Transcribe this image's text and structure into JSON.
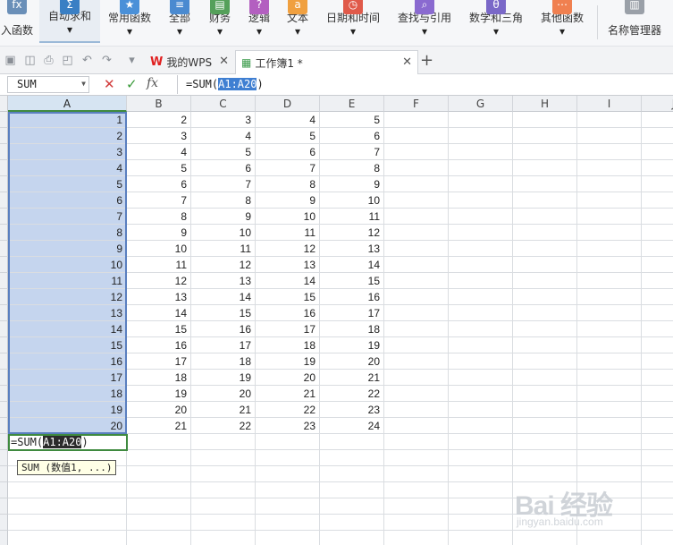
{
  "ribbon": {
    "items": [
      {
        "label": "入函数",
        "icon": "fx-icon",
        "glyph": "fx",
        "color": "#6a8fb8"
      },
      {
        "label": "自动求和",
        "icon": "sigma-icon",
        "glyph": "Σ",
        "color": "#3a7fc4"
      },
      {
        "label": "常用函数",
        "icon": "star-icon",
        "glyph": "★",
        "color": "#4a90d8"
      },
      {
        "label": "全部",
        "icon": "list-icon",
        "glyph": "≡",
        "color": "#4a8ad0"
      },
      {
        "label": "财务",
        "icon": "finance-icon",
        "glyph": "▤",
        "color": "#55a05a"
      },
      {
        "label": "逻辑",
        "icon": "question-icon",
        "glyph": "?",
        "color": "#b35fc0"
      },
      {
        "label": "文本",
        "icon": "text-icon",
        "glyph": "a",
        "color": "#f0a040"
      },
      {
        "label": "日期和时间",
        "icon": "clock-icon",
        "glyph": "◷",
        "color": "#e05a4a"
      },
      {
        "label": "查找与引用",
        "icon": "search-icon",
        "glyph": "⌕",
        "color": "#8a6ad0"
      },
      {
        "label": "数学和三角",
        "icon": "theta-icon",
        "glyph": "θ",
        "color": "#7a68c8"
      },
      {
        "label": "其他函数",
        "icon": "more-functions-icon",
        "glyph": "⋯",
        "color": "#f08050"
      },
      {
        "label": "名称管理器",
        "icon": "name-manager-icon",
        "glyph": "▥",
        "color": "#9aa0a8"
      }
    ]
  },
  "tabs": {
    "wps": "我的WPS",
    "workbook": "工作簿1 *"
  },
  "formula_bar": {
    "name_box": "SUM",
    "formula_prefix": "=SUM(",
    "formula_ref": "A1:A20",
    "formula_suffix": ")"
  },
  "grid": {
    "columns": [
      "A",
      "B",
      "C",
      "D",
      "E",
      "F",
      "G",
      "H",
      "I",
      "J"
    ],
    "rows": [
      [
        1,
        2,
        3,
        4,
        5
      ],
      [
        2,
        3,
        4,
        5,
        6
      ],
      [
        3,
        4,
        5,
        6,
        7
      ],
      [
        4,
        5,
        6,
        7,
        8
      ],
      [
        5,
        6,
        7,
        8,
        9
      ],
      [
        6,
        7,
        8,
        9,
        10
      ],
      [
        7,
        8,
        9,
        10,
        11
      ],
      [
        8,
        9,
        10,
        11,
        12
      ],
      [
        9,
        10,
        11,
        12,
        13
      ],
      [
        10,
        11,
        12,
        13,
        14
      ],
      [
        11,
        12,
        13,
        14,
        15
      ],
      [
        12,
        13,
        14,
        15,
        16
      ],
      [
        13,
        14,
        15,
        16,
        17
      ],
      [
        14,
        15,
        16,
        17,
        18
      ],
      [
        15,
        16,
        17,
        18,
        19
      ],
      [
        16,
        17,
        18,
        19,
        20
      ],
      [
        17,
        18,
        19,
        20,
        21
      ],
      [
        18,
        19,
        20,
        21,
        22
      ],
      [
        19,
        20,
        21,
        22,
        23
      ],
      [
        20,
        21,
        22,
        23,
        24
      ]
    ],
    "edit_cell": {
      "prefix": "=SUM(",
      "ref": "A1:A20",
      "suffix": ")"
    },
    "tooltip": "SUM (数值1, ...)"
  },
  "watermark": {
    "main": "Bai 经验",
    "sub": "jingyan.baidu.com"
  }
}
